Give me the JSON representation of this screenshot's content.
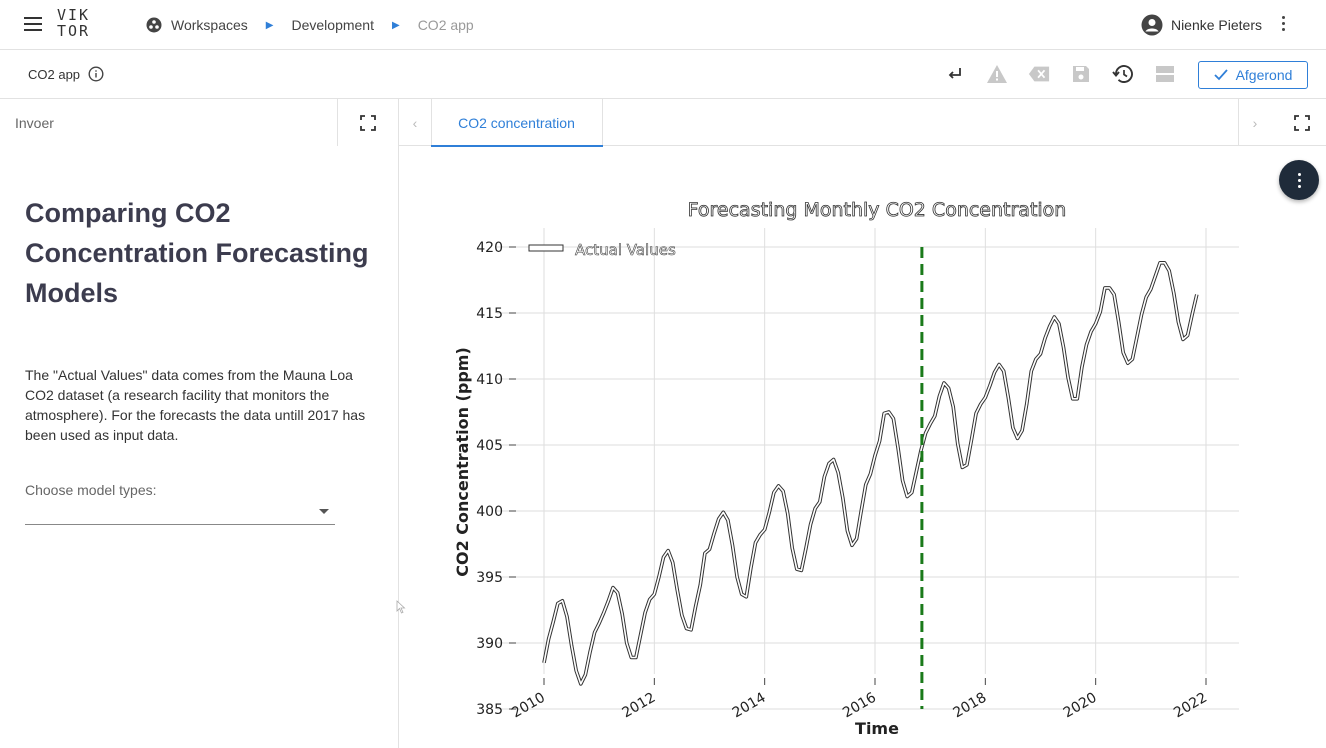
{
  "topbar": {
    "logo_line1": "VIK",
    "logo_line2": "TOR",
    "breadcrumbs": [
      "Workspaces",
      "Development",
      "CO2 app"
    ],
    "user_name": "Nienke Pieters"
  },
  "toolbar": {
    "app_name": "CO2 app",
    "done_label": "Afgerond"
  },
  "left_panel": {
    "title": "Invoer",
    "heading": "Comparing CO2 Concentration Forecasting Models",
    "paragraph": "The \"Actual Values\" data comes from the Mauna Loa CO2 dataset (a research facility that monitors the atmosphere). For the forecasts the data untill 2017 has been used as input data.",
    "select_label": "Choose model types:",
    "select_value": ""
  },
  "right_panel": {
    "tab_label": "CO2 concentration"
  },
  "colors": {
    "accent": "#2f7fd8",
    "forecast_line": "#1a7a1a",
    "heading": "#3c3c4e"
  },
  "chart_data": {
    "type": "line",
    "title": "Forecasting Monthly CO2 Concentration",
    "xlabel": "Time",
    "ylabel": "CO2 Concentration (ppm)",
    "xlim": [
      2010,
      2022
    ],
    "ylim": [
      385,
      420
    ],
    "xticks": [
      2010,
      2012,
      2014,
      2016,
      2018,
      2020,
      2022
    ],
    "yticks": [
      385,
      390,
      395,
      400,
      405,
      410,
      415,
      420
    ],
    "grid": true,
    "legend": "top-left",
    "vline_x": 2016.85,
    "series": [
      {
        "name": "Actual Values",
        "x_start": 2010.0,
        "x_step": 0.083333,
        "values": [
          388.5,
          390.3,
          391.6,
          393.0,
          393.2,
          392.0,
          389.8,
          387.9,
          386.9,
          387.6,
          389.3,
          390.8,
          391.5,
          392.3,
          393.2,
          394.2,
          393.8,
          392.2,
          390.0,
          388.9,
          388.9,
          390.6,
          392.3,
          393.3,
          393.7,
          395.0,
          396.5,
          397.0,
          396.1,
          394.0,
          392.1,
          391.1,
          391.0,
          392.8,
          394.4,
          396.8,
          397.1,
          398.3,
          399.4,
          399.9,
          399.3,
          397.4,
          395.0,
          393.7,
          393.5,
          395.7,
          397.6,
          398.2,
          398.6,
          399.9,
          401.4,
          401.9,
          401.5,
          399.8,
          397.2,
          395.6,
          395.5,
          397.2,
          399.0,
          400.2,
          400.7,
          402.6,
          403.6,
          403.9,
          402.9,
          401.0,
          398.5,
          397.4,
          397.9,
          400.0,
          402.0,
          402.8,
          404.2,
          405.3,
          407.4,
          407.5,
          407.0,
          404.8,
          402.3,
          401.1,
          401.4,
          403.0,
          404.6,
          405.9,
          406.6,
          407.2,
          408.7,
          409.7,
          409.3,
          407.9,
          405.1,
          403.3,
          403.5,
          405.4,
          407.4,
          408.1,
          408.6,
          409.5,
          410.5,
          411.1,
          410.6,
          408.6,
          406.3,
          405.5,
          406.1,
          408.1,
          410.6,
          411.5,
          411.9,
          413.1,
          414.0,
          414.7,
          414.2,
          412.4,
          410.1,
          408.5,
          408.5,
          410.9,
          412.6,
          413.6,
          414.2,
          415.1,
          416.9,
          416.9,
          416.4,
          414.3,
          412.0,
          411.2,
          411.5,
          413.2,
          414.9,
          416.2,
          416.8,
          417.8,
          418.8,
          418.8,
          418.2,
          416.5,
          414.3,
          413.0,
          413.3,
          414.9,
          416.4
        ]
      }
    ]
  }
}
